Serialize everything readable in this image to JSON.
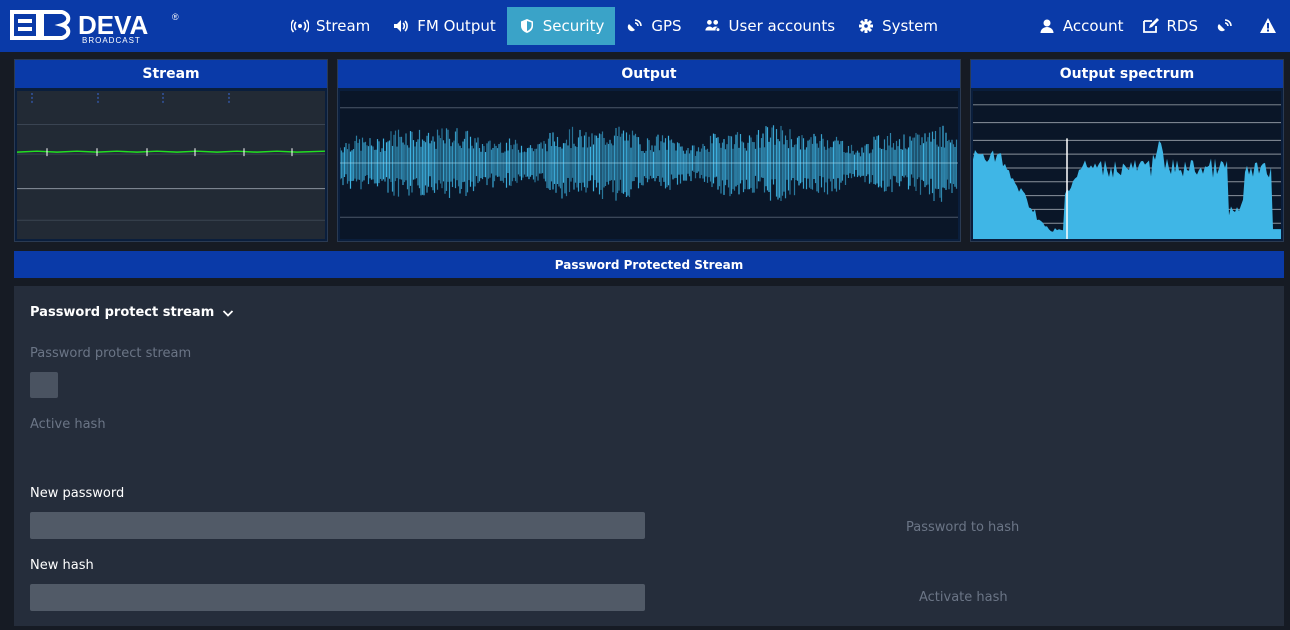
{
  "brand": {
    "logo_text": "DEVA",
    "logo_sub": "BROADCAST",
    "logo_mark": "®"
  },
  "nav": {
    "items": [
      {
        "label": "Stream",
        "icon": "broadcast-icon",
        "active": false
      },
      {
        "label": "FM Output",
        "icon": "speaker-icon",
        "active": false
      },
      {
        "label": "Security",
        "icon": "shield-icon",
        "active": true
      },
      {
        "label": "GPS",
        "icon": "satellite-icon",
        "active": false
      },
      {
        "label": "User accounts",
        "icon": "users-icon",
        "active": false
      },
      {
        "label": "System",
        "icon": "gear-icon",
        "active": false
      }
    ],
    "right": [
      {
        "label": "Account",
        "icon": "user-icon"
      },
      {
        "label": "RDS",
        "icon": "edit-icon"
      },
      {
        "label": "",
        "icon": "satellite-icon"
      },
      {
        "label": "",
        "icon": "warning-icon"
      }
    ]
  },
  "panels": {
    "stream": {
      "title": "Stream"
    },
    "output": {
      "title": "Output"
    },
    "spectrum": {
      "title": "Output spectrum"
    }
  },
  "colors": {
    "accent": "#0a3aa8",
    "active_tab": "#3aa3c8",
    "waveform": "#3fb6e6",
    "stream_line": "#22e022"
  },
  "section": {
    "title": "Password Protected Stream"
  },
  "form": {
    "collapse_title": "Password protect stream",
    "checkbox_label": "Password protect stream",
    "checkbox_checked": false,
    "active_hash_label": "Active hash",
    "new_password_label": "New password",
    "new_password_value": "",
    "password_to_hash_button": "Password to hash",
    "new_hash_label": "New hash",
    "new_hash_value": "",
    "activate_hash_button": "Activate hash"
  }
}
